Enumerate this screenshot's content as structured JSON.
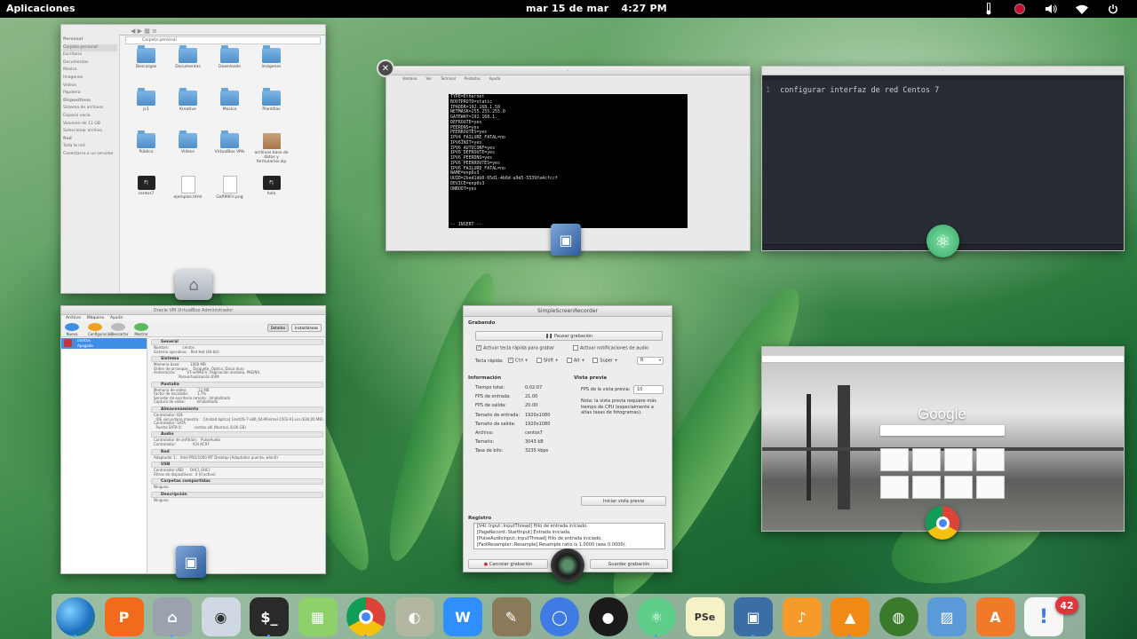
{
  "panel": {
    "apps_label": "Aplicaciones",
    "date": "mar 15 de mar",
    "time": "4:27 PM",
    "tray_icons": [
      "thermometer-icon",
      "record-icon",
      "volume-icon",
      "wifi-icon",
      "power-icon"
    ]
  },
  "files": {
    "sidebar": [
      {
        "label": "Personal",
        "header": true
      },
      {
        "label": "Carpeta personal",
        "selected": true
      },
      {
        "label": "Escritorio"
      },
      {
        "label": "Documentos"
      },
      {
        "label": "Música"
      },
      {
        "label": "Imágenes"
      },
      {
        "label": "Vídeos"
      },
      {
        "label": "Papelera"
      },
      {
        "label": "Dispositivos",
        "header": true
      },
      {
        "label": "Sistema de archivos"
      },
      {
        "label": "Espacio vacío"
      },
      {
        "label": "Volumen de 11 GB"
      },
      {
        "label": "Seleccionar archivo"
      },
      {
        "label": "Red",
        "header": true
      },
      {
        "label": "Toda la red"
      },
      {
        "label": "Conectarse a un servidor"
      }
    ],
    "path": "Carpeta personal",
    "items": [
      {
        "label": "Descargas",
        "type": "folder"
      },
      {
        "label": "Documentos",
        "type": "folder"
      },
      {
        "label": "Downloads",
        "type": "folder"
      },
      {
        "label": "Imágenes",
        "type": "folder"
      },
      {
        "label": "jc1",
        "type": "folder"
      },
      {
        "label": "Kreative",
        "type": "folder"
      },
      {
        "label": "Música",
        "type": "folder"
      },
      {
        "label": "Plantillas",
        "type": "folder"
      },
      {
        "label": "Público",
        "type": "folder"
      },
      {
        "label": "Vídeos",
        "type": "folder"
      },
      {
        "label": "VirtualBox VMs",
        "type": "folder"
      },
      {
        "label": "archivos base de datos y formularios.zip",
        "type": "archive"
      },
      {
        "label": "centos7",
        "type": "terminal"
      },
      {
        "label": "ejemplos.html",
        "type": "document"
      },
      {
        "label": "Gafi99Fri.png",
        "type": "document"
      },
      {
        "label": "hola",
        "type": "terminal"
      }
    ]
  },
  "editor": {
    "menu": [
      "Ventana",
      "Ver",
      "Terminal",
      "Pestañas",
      "Ayuda"
    ],
    "lines": [
      "TYPE=Ethernet",
      "BOOTPROTO=static",
      "IPADDR=192.168.1.50",
      "NETMASK=255.255.255.0",
      "GATEWAY=192.168.1._",
      "DEFROUTE=yes",
      "PEERDNS=yes",
      "PEERROUTES=yes",
      "IPV4_FAILURE_FATAL=no",
      "IPV6INIT=yes",
      "IPV6_AUTOCONF=yes",
      "IPV6_DEFROUTE=yes",
      "IPV6_PEERDNS=yes",
      "IPV6_PEERROUTES=yes",
      "IPV6_FAILURE_FATAL=no",
      "NAME=enp0s3",
      "UUID=2bed1db0-65d1-4b6d-a9d5-5539fa4cfccf",
      "DEVICE=enp0s3",
      "ONBOOT=yes",
      "",
      "",
      "",
      "",
      "",
      "",
      "-- INSERT --"
    ]
  },
  "atom": {
    "line_number": "1",
    "text": "configurar interfaz de red Centos 7"
  },
  "vbox": {
    "title": "Oracle VM VirtualBox Administrador",
    "menu": [
      "Archivo",
      "Máquina",
      "Ayuda"
    ],
    "toolbar": [
      "Nueva",
      "Configuración",
      "Descartar",
      "Mostrar"
    ],
    "tab_details": "Detalles",
    "tab_snapshots": "Instantáneas",
    "vm_name": "centos",
    "vm_state": "Apagada",
    "sections": [
      {
        "title": "General",
        "text": "Nombre:            centos\nSistema operativo:   Red Hat (64-bit)"
      },
      {
        "title": "Sistema",
        "text": "Memoria base:         1000 MB\nOrden de arranque:    Disquete, Óptica, Disco duro\nAceleración:          VT-x/AMD-V, Paginación anidada, PAE/NX,\n                      Paravirtualización KVM"
      },
      {
        "title": "Pantalla",
        "text": "Memoria de vídeo:          12 MB\nFactor de escalado:        1,7%\nServidor de escritorio remoto:  Inhabilitado\nCaptura de vídeo:          Inhabilitada"
      },
      {
        "title": "Almacenamiento",
        "text": "Controlador: IDE\n  IDE secundario maestro:   [Unidad óptica] CentOS-7-x86_64-Minimal-1503-01.iso (636,00 MB)\nControlador: SATA\n  Puerto SATA 0:           centos.vdi (Normal, 8,00 GB)"
      },
      {
        "title": "Audio",
        "text": "Controlador de anfitrión:   PulseAudio\nControlador:               ICH AC97"
      },
      {
        "title": "Red",
        "text": "Adaptador 1:   Intel PRO/1000 MT Desktop (Adaptador puente, wlan0)"
      },
      {
        "title": "USB",
        "text": "Controlador USB:     OHCI, EHCI\nFiltros de dispositivos:  0 (0 activo)"
      },
      {
        "title": "Carpetas compartidas",
        "text": "Ninguno"
      },
      {
        "title": "Descripción",
        "text": "Ninguno"
      }
    ]
  },
  "ssr": {
    "title": "SimpleScreenRecorder",
    "recording_header": "Grabando",
    "pause_button": "Pausar grabación",
    "hotkey_check": "Activar tecla rápida para grabar",
    "notify_check": "Activar notificaciones de audio",
    "hotkey_label": "Tecla rápida:",
    "modifiers": [
      {
        "label": "Ctrl +",
        "checked": true
      },
      {
        "label": "Shift +",
        "checked": false
      },
      {
        "label": "Alt +",
        "checked": false
      },
      {
        "label": "Super +",
        "checked": false
      }
    ],
    "key_value": "R",
    "info_header": "Información",
    "info": [
      {
        "label": "Tiempo total:",
        "value": "0:02:07"
      },
      {
        "label": "FPS de entrada:",
        "value": "21.00"
      },
      {
        "label": "FPS de salida:",
        "value": "20.00"
      },
      {
        "label": "Tamaño de entrada:",
        "value": "1920x1080"
      },
      {
        "label": "Tamaño de salida:",
        "value": "1920x1080"
      },
      {
        "label": "Archivo:",
        "value": "centos7"
      },
      {
        "label": "Tamaño:",
        "value": "3043 kB"
      },
      {
        "label": "Tasa de bits:",
        "value": "3235 kbps"
      }
    ],
    "preview_header": "Vista previa",
    "preview_fps_label": "FPS de la vista previa:",
    "preview_fps_value": "10",
    "preview_note": "Nota: la vista previa requiere más tiempo de CPU (especialmente a altas tasas de fotogramas).",
    "start_preview_button": "Iniciar vista previa",
    "log_header": "Registro",
    "log": [
      "[V4l::Input::InputThread] Hilo de entrada iniciado.",
      "[PageRecord::StartInput] Entrada iniciada.",
      "[PulseAudioInput::InputThread] Hilo de entrada iniciado.",
      "[FastResampler::Resample] Resample ratio is 1.0000 (was 0.0000)."
    ],
    "cancel_button": "Cancelar grabación",
    "save_button": "Guardar grabación"
  },
  "chrome": {
    "logo_text": "Google"
  },
  "dock": {
    "items": [
      {
        "name": "browser-globe-icon",
        "color": "#2f8fd6",
        "round": true,
        "glyph": ""
      },
      {
        "name": "presentation-icon",
        "color": "#f26b1d",
        "glyph": "P"
      },
      {
        "name": "files-icon",
        "color": "#9aa3ad",
        "glyph": "⌂"
      },
      {
        "name": "settings-toggle-icon",
        "color": "#cfd8e3",
        "glyph": "◉"
      },
      {
        "name": "terminal-icon",
        "color": "#2a2a2a",
        "glyph": "$_"
      },
      {
        "name": "spreadsheet-icon",
        "color": "#8ed16b",
        "glyph": "▦"
      },
      {
        "name": "chrome-icon",
        "color": "#e8453c",
        "round": true,
        "glyph": ""
      },
      {
        "name": "disk-usage-icon",
        "color": "#b2b8a0",
        "glyph": "◐"
      },
      {
        "name": "wps-writer-icon",
        "color": "#2f8fff",
        "glyph": "W"
      },
      {
        "name": "gimp-icon",
        "color": "#8a7a5a",
        "glyph": "✎"
      },
      {
        "name": "chromium-icon",
        "color": "#3e7be3",
        "round": true,
        "glyph": "◯"
      },
      {
        "name": "camera-recorder-icon",
        "color": "#1a1a1a",
        "round": true,
        "glyph": "●"
      },
      {
        "name": "atom-icon",
        "color": "#5fce8b",
        "round": true,
        "glyph": "⚛"
      },
      {
        "name": "pseint-icon",
        "color": "#f6f2c8",
        "glyph": "PSe"
      },
      {
        "name": "virtualbox-icon",
        "color": "#3a6ea5",
        "glyph": "▣"
      },
      {
        "name": "music-icon",
        "color": "#f59a2b",
        "glyph": "♪"
      },
      {
        "name": "vlc-icon",
        "color": "#f08a14",
        "glyph": "▲"
      },
      {
        "name": "earth-icon",
        "color": "#3a7a2a",
        "round": true,
        "glyph": "◍"
      },
      {
        "name": "image-viewer-icon",
        "color": "#5a9ad8",
        "glyph": "▨"
      },
      {
        "name": "software-center-icon",
        "color": "#f07a2a",
        "glyph": "A"
      },
      {
        "name": "notes-icon",
        "color": "#f7f7f7",
        "glyph": "!"
      }
    ],
    "badge_count": "42"
  }
}
